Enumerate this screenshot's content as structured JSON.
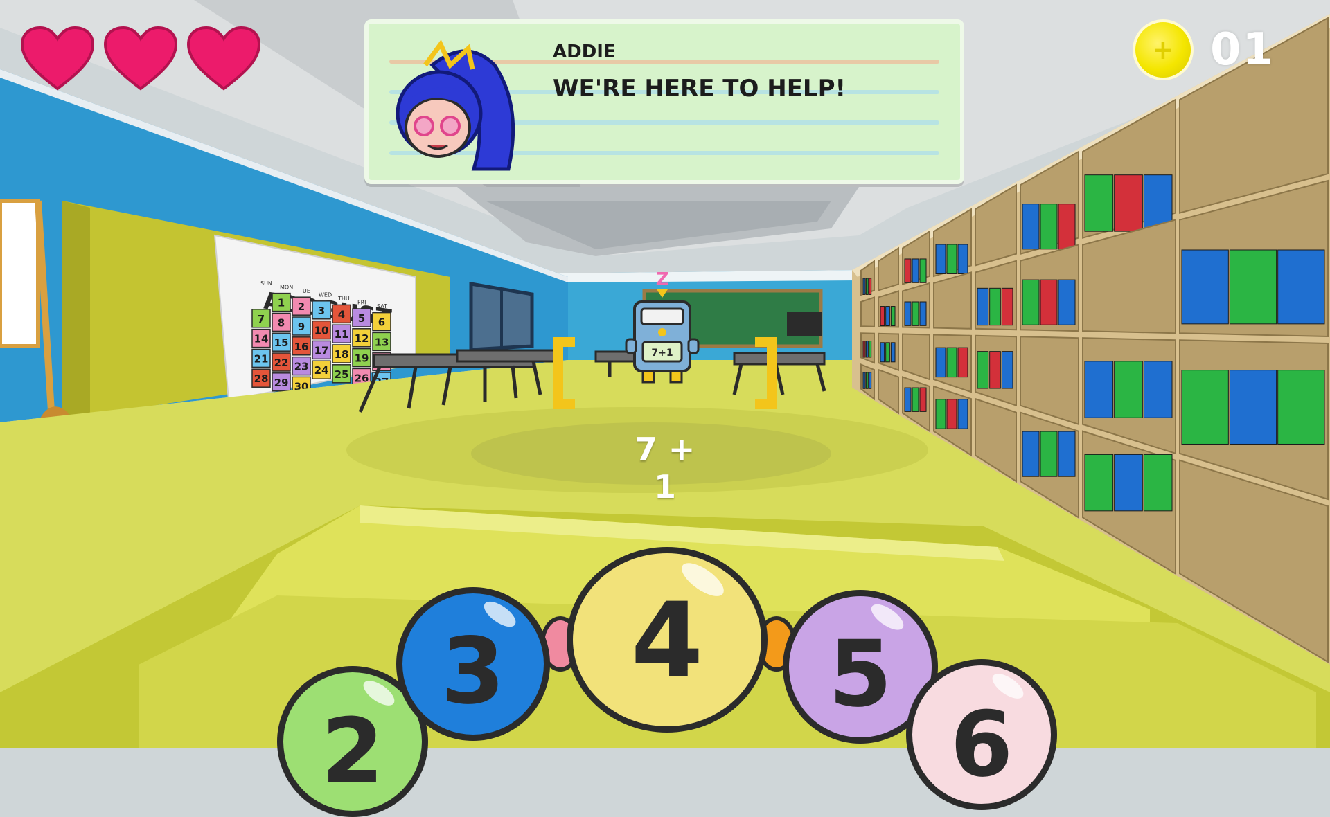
{
  "hud": {
    "hearts": 3,
    "coin_count": "01",
    "colors": {
      "heart": "#ec1b6b",
      "coin": "#f4e600"
    }
  },
  "dialog": {
    "speaker": "ADDIE",
    "text": "WE'RE HERE TO HELP!"
  },
  "scene": {
    "calendar_title": "ADDGUST",
    "calendar_days": [
      "SUN",
      "MON",
      "TUE",
      "WED",
      "THU",
      "FRI",
      "SAT"
    ],
    "calendar_dates": [
      "1",
      "2",
      "3",
      "4",
      "5",
      "6",
      "7",
      "8",
      "9",
      "10",
      "11",
      "12",
      "13",
      "14",
      "15",
      "16",
      "17",
      "18",
      "19",
      "20",
      "21",
      "22",
      "23",
      "24",
      "25",
      "26",
      "27",
      "28",
      "29",
      "30"
    ],
    "robot_screen": "7+1",
    "robot_status": "Z"
  },
  "problem": {
    "equation": "7 + 1"
  },
  "answers": [
    "2",
    "3",
    "4",
    "5",
    "6"
  ]
}
